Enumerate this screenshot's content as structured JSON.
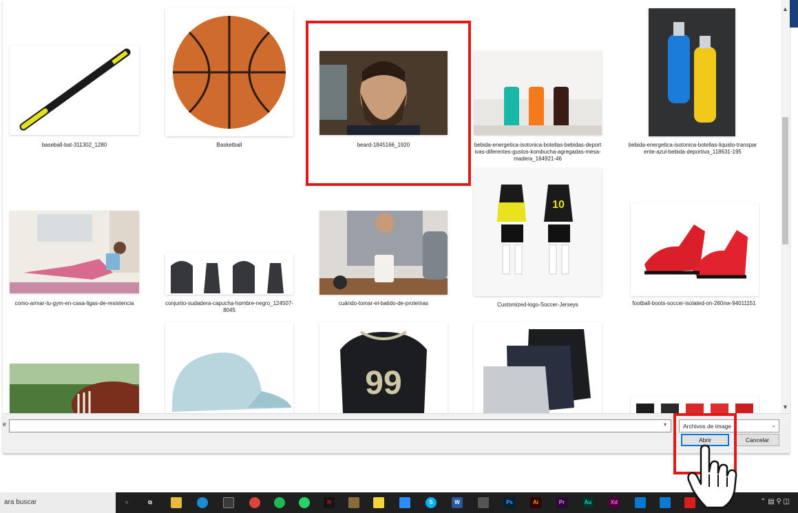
{
  "dialog": {
    "files": [
      {
        "name": "baseball-bat-311302_1280",
        "icon": "baseball-bat-image"
      },
      {
        "name": "Basketball",
        "icon": "basketball-image"
      },
      {
        "name": "beard-1845166_1920",
        "icon": "bearded-man-image"
      },
      {
        "name": "bebida-energetica-isotonica-botellas-bebidas-deportivas-diferentes-gustos-kombucha-agregadas-mesa-madera_164921-46",
        "icon": "drink-bottles-image"
      },
      {
        "name": "bebida-energetica-isotonica-botellas-liquido-transparente-azul-bebida-deportiva_118631-195",
        "icon": "sports-drink-bottles-image"
      },
      {
        "name": "como-armar-tu-gym-en-casa-ligas-de-resistencia",
        "icon": "home-gym-woman-image"
      },
      {
        "name": "conjunto-sudadera-capucha-hombre-negro_124507-8045",
        "icon": "black-hoodies-image"
      },
      {
        "name": "cuándo-tomar-el-batido-de-proteínas",
        "icon": "protein-shake-image"
      },
      {
        "name": "Customized-logo-Soccer-Jerseys",
        "icon": "soccer-jerseys-image"
      },
      {
        "name": "football-boots-soccer-isolated-on-260nw-94011151",
        "icon": "red-football-boots-image"
      },
      {
        "name": "",
        "icon": "american-football-image"
      },
      {
        "name": "",
        "icon": "light-blue-cap-image"
      },
      {
        "name": "",
        "icon": "football-jersey-99-image"
      },
      {
        "name": "",
        "icon": "shorts-image"
      },
      {
        "name": "",
        "icon": "colored-shirts-image"
      }
    ],
    "jersey_number": "99",
    "soccer_number": "10",
    "filename_value": "",
    "filetype_selected": "Archivos de image",
    "open_label": "Abrir",
    "cancel_label": "Cancelar",
    "name_label_fragment": "e"
  },
  "taskbar": {
    "search_text": "ara buscar",
    "apps": [
      "task-view",
      "file-explorer",
      "edge",
      "store",
      "chrome",
      "spotify",
      "whatsapp",
      "netflix",
      "books",
      "sticky-notes",
      "zoom",
      "skype",
      "word",
      "sheets",
      "photoshop",
      "illustrator",
      "premiere",
      "audition",
      "xd",
      "mail",
      "media",
      "acrobat"
    ],
    "app_letters": {
      "word": "W",
      "photoshop": "Ps",
      "illustrator": "Ai",
      "premiere": "Pr",
      "audition": "Au",
      "xd": "Xd"
    }
  },
  "colors": {
    "highlight": "#e01818",
    "taskbar": "#1f1f1f",
    "accent": "#1a3f7a"
  }
}
